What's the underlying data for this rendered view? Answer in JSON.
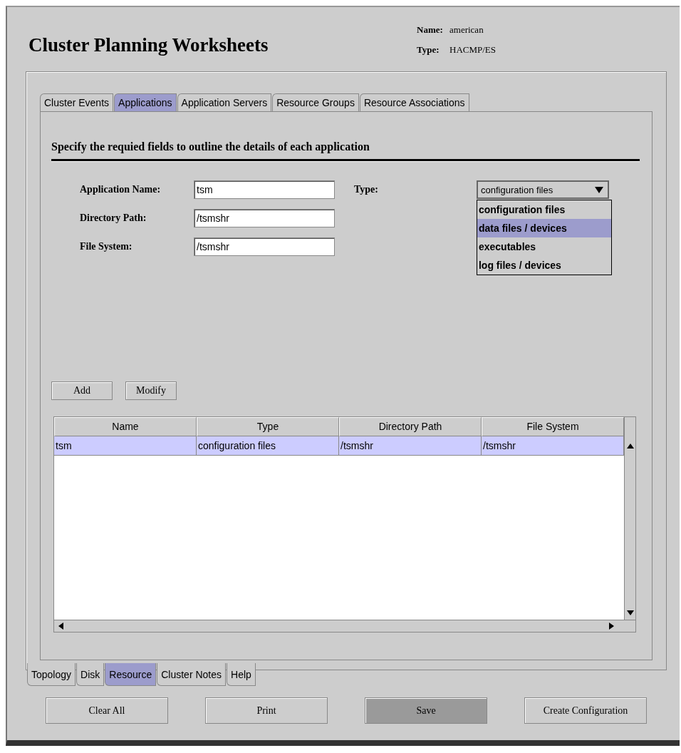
{
  "window": {
    "title": "Cluster Planning Worksheets"
  },
  "info": [
    {
      "label": "Name:",
      "value": "american"
    },
    {
      "label": "Type:",
      "value": "HACMP/ES"
    }
  ],
  "tabs": [
    {
      "label": "Cluster Events",
      "selected": false
    },
    {
      "label": "Applications",
      "selected": true
    },
    {
      "label": "Application Servers",
      "selected": false
    },
    {
      "label": "Resource Groups",
      "selected": false
    },
    {
      "label": "Resource Associations",
      "selected": false
    }
  ],
  "heading": "Specify the requied fields to outline the details of each application",
  "fields": [
    {
      "label": "Application Name:",
      "value": "tsm"
    },
    {
      "label": "Directory Path:",
      "value": "/tsmshr"
    },
    {
      "label": "File System:",
      "value": "/tsmshr"
    }
  ],
  "type_field": {
    "label": "Type:",
    "value": "configuration files",
    "expanded": true,
    "options": [
      {
        "label": "configuration files",
        "highlighted": false
      },
      {
        "label": "data files / devices",
        "highlighted": true
      },
      {
        "label": "executables",
        "highlighted": false
      },
      {
        "label": "log files / devices",
        "highlighted": false
      }
    ]
  },
  "actions": [
    "Add",
    "Modify"
  ],
  "table": {
    "columns": [
      "Name",
      "Type",
      "Directory Path",
      "File System"
    ],
    "rows": [
      {
        "cells": [
          "tsm",
          "configuration files",
          "/tsmshr",
          "/tsmshr"
        ],
        "selected": true
      }
    ]
  },
  "bottom_tabs": [
    {
      "label": "Topology",
      "selected": false
    },
    {
      "label": "Disk",
      "selected": false
    },
    {
      "label": "Resource",
      "selected": true
    },
    {
      "label": "Cluster Notes",
      "selected": false
    },
    {
      "label": "Help",
      "selected": false
    }
  ],
  "buttons": [
    {
      "label": "Clear All",
      "pressed": false
    },
    {
      "label": "Print",
      "pressed": false
    },
    {
      "label": "Save",
      "pressed": true
    },
    {
      "label": "Create Configuration",
      "pressed": false
    }
  ]
}
